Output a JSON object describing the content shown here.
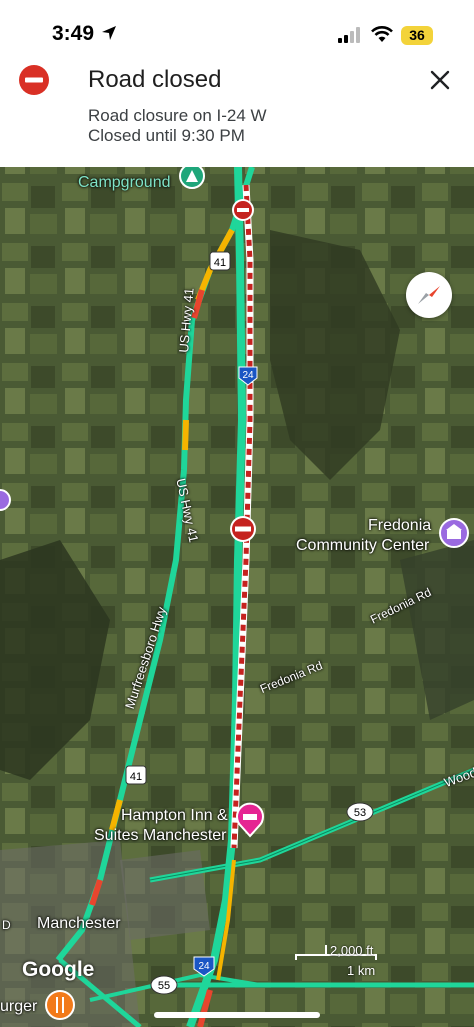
{
  "status_bar": {
    "time": "3:49",
    "battery": "36"
  },
  "alert": {
    "title": "Road closed",
    "line1": "Road closure on I-24 W",
    "line2": "Closed until 9:30 PM"
  },
  "map": {
    "labels": {
      "campground": "Campground",
      "us_hwy_41_a": "US Hwy 41",
      "us_hwy_41_b": "US Hwy 41",
      "murfreesboro_hwy": "Murfreesboro Hwy",
      "fredonia_cc_1": "Fredonia",
      "fredonia_cc_2": "Community Center",
      "fredonia_rd_a": "Fredonia Rd",
      "fredonia_rd_b": "Fredonia Rd",
      "woodbury": "Woodb",
      "hampton_1": "Hampton Inn &",
      "hampton_2": "Suites Manchester",
      "manchester": "Manchester",
      "burger": "urger",
      "d": "D"
    },
    "shields": {
      "i24_top": "24",
      "i24_bottom": "24",
      "us41_top": "41",
      "us41_bottom": "41",
      "r53": "53",
      "r55": "55"
    },
    "google": "Google",
    "scale_ft": "2,000 ft",
    "scale_km": "1 km"
  },
  "colors": {
    "closed": "#c5221f",
    "traffic_green": "#1fd69a",
    "traffic_yellow": "#f5b400",
    "traffic_red": "#e8452e",
    "poi_purple": "#9a6ae0",
    "hotel_pink": "#e52592",
    "food_orange": "#f27a1a"
  },
  "icons": [
    "location-arrow-icon",
    "signal-icon",
    "wifi-icon",
    "road-closed-icon",
    "close-icon",
    "compass-icon",
    "campground-icon",
    "hotel-icon",
    "food-icon",
    "community-center-icon"
  ]
}
